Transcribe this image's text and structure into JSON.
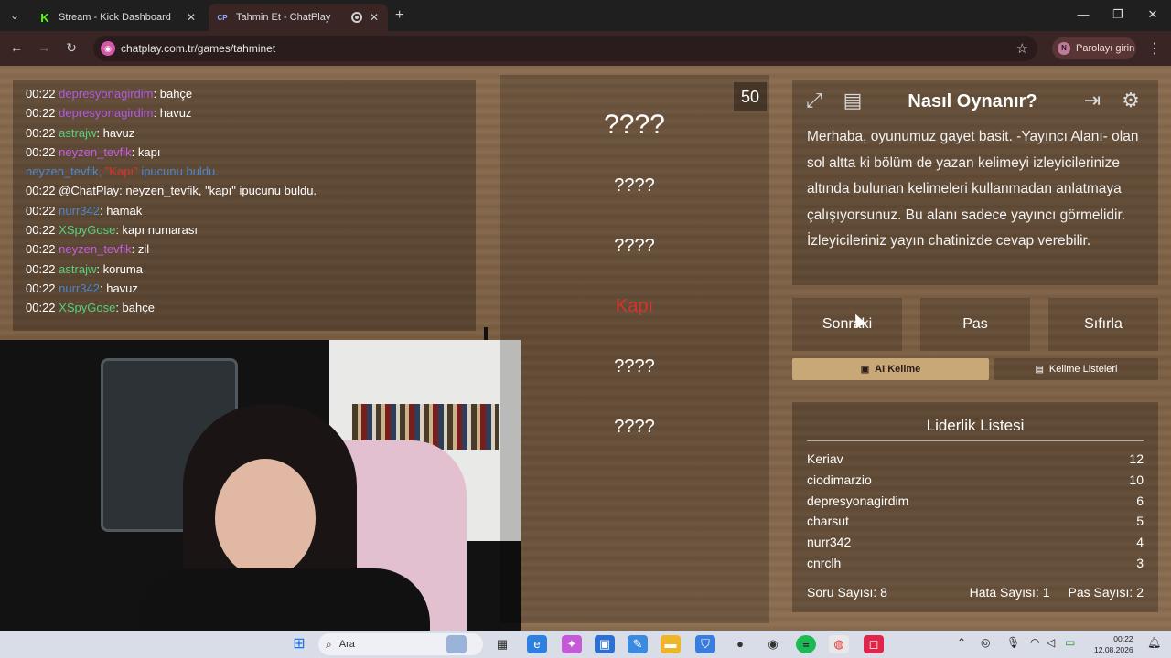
{
  "browser": {
    "tabs": [
      {
        "title": "Stream - Kick Dashboard",
        "icon": "kick-icon"
      },
      {
        "title": "Tahmin Et - ChatPlay",
        "icon": "chatplay-icon",
        "favicon_text": "CP",
        "active": true
      }
    ],
    "url": "chatplay.com.tr/games/tahminet",
    "password_button": "Parolayı girin",
    "profile_initial": "N"
  },
  "chat": {
    "messages": [
      {
        "time": "00:22",
        "user": "depresyonagirdim",
        "color": "#b15ae0",
        "text": ": bahçe"
      },
      {
        "time": "00:22",
        "user": "depresyonagirdim",
        "color": "#b15ae0",
        "text": ": havuz"
      },
      {
        "time": "00:22",
        "user": "astrajw",
        "color": "#56d07a",
        "text": ": havuz"
      },
      {
        "time": "00:22",
        "user": "neyzen_tevfik",
        "color": "#c45ce0",
        "text": ": kapı"
      },
      {
        "system": true,
        "part1": "neyzen_tevfik, ",
        "part2": "\"Kapı\"",
        "part3": " ipucunu buldu."
      },
      {
        "time": "00:22",
        "user": "@ChatPlay",
        "color": "#ffffff",
        "text": ": neyzen_tevfik, \"kapı\" ipucunu buldu."
      },
      {
        "time": "00:22",
        "user": "nurr342",
        "color": "#4f85c9",
        "text": ": hamak"
      },
      {
        "time": "00:22",
        "user": "XSpyGose",
        "color": "#56d07a",
        "text": ": kapı numarası"
      },
      {
        "time": "00:22",
        "user": "neyzen_tevfik",
        "color": "#c45ce0",
        "text": ": zil"
      },
      {
        "time": "00:22",
        "user": "astrajw",
        "color": "#56d07a",
        "text": ": koruma"
      },
      {
        "time": "00:22",
        "user": "nurr342",
        "color": "#4f85c9",
        "text": ": havuz"
      },
      {
        "time": "00:22",
        "user": "XSpyGose",
        "color": "#56d07a",
        "text": ": bahçe"
      }
    ]
  },
  "game": {
    "counter": "50",
    "words": [
      {
        "text": "????",
        "big": true
      },
      {
        "text": "????"
      },
      {
        "text": "????"
      },
      {
        "text": "Kapı",
        "found": true
      },
      {
        "text": "????"
      },
      {
        "text": "????"
      }
    ]
  },
  "howto": {
    "title": "Nasıl Oynanır?",
    "text": "Merhaba, oyunumuz gayet basit. -Yayıncı Alanı- olan sol altta ki bölüm de yazan kelimeyi izleyicilerinize altında bulunan kelimeleri kullanmadan anlatmaya çalışıyorsunuz. Bu alanı sadece yayıncı görmelidir. İzleyicileriniz yayın chatinizde cevap verebilir."
  },
  "buttons": {
    "next": "Sonraki",
    "pass": "Pas",
    "reset": "Sıfırla"
  },
  "word_tabs": {
    "ai": "AI Kelime",
    "lists": "Kelime Listeleri"
  },
  "leaderboard": {
    "title": "Liderlik Listesi",
    "rows": [
      {
        "name": "Keriav",
        "score": "12"
      },
      {
        "name": "ciodimarzio",
        "score": "10"
      },
      {
        "name": "depresyonagirdim",
        "score": "6"
      },
      {
        "name": "charsut",
        "score": "5"
      },
      {
        "name": "nurr342",
        "score": "4"
      },
      {
        "name": "cnrclh",
        "score": "3"
      }
    ],
    "stats": {
      "questions": "Soru Sayısı: 8",
      "errors": "Hata Sayısı: 1",
      "passes": "Pas Sayısı: 2"
    }
  },
  "taskbar": {
    "search_placeholder": "Ara",
    "time": "00:22",
    "date": "12.08.2026"
  }
}
